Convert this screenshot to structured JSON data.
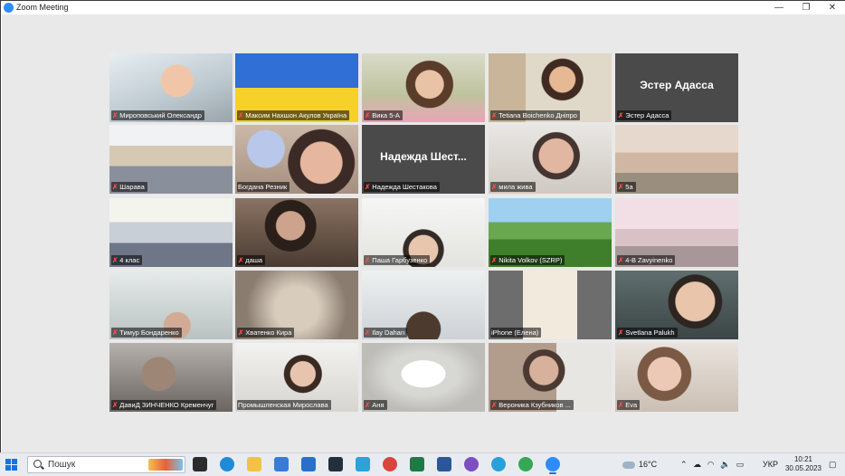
{
  "window": {
    "title": "Zoom Meeting",
    "controls": {
      "minimize": "—",
      "maximize": "❐",
      "close": "✕"
    }
  },
  "participants": [
    {
      "name": "Мироповський Олександр",
      "muted": true,
      "video": true,
      "scene": "boy-glasses"
    },
    {
      "name": "Максим Нахшон Акулов Україна",
      "muted": true,
      "video": true,
      "scene": "flag"
    },
    {
      "name": "Вика 5-А",
      "muted": true,
      "video": true,
      "scene": "girl-room"
    },
    {
      "name": "Tetiana Boichenko Дніпро",
      "muted": true,
      "video": true,
      "scene": "teacher"
    },
    {
      "name": "Эстер Адасса",
      "muted": true,
      "video": false,
      "display_name": "Эстер Адасса"
    },
    {
      "name": "Шарава",
      "muted": true,
      "video": true,
      "scene": "classroom"
    },
    {
      "name": "Богдана Резник",
      "muted": false,
      "video": true,
      "scene": "badge",
      "active_speaker": true
    },
    {
      "name": "Надежда Шестакова",
      "muted": true,
      "video": false,
      "display_name": "Надежда Шест..."
    },
    {
      "name": "мила жива",
      "muted": true,
      "video": true,
      "scene": "girl-headset"
    },
    {
      "name": "5а",
      "muted": true,
      "video": true,
      "scene": "classroom2"
    },
    {
      "name": "4 клас",
      "muted": true,
      "video": true,
      "scene": "class-kids"
    },
    {
      "name": "даша",
      "muted": true,
      "video": true,
      "scene": "girl-dark"
    },
    {
      "name": "Паша Гарбузенко",
      "muted": true,
      "video": true,
      "scene": "boy-bright"
    },
    {
      "name": "Nikita Volkov (SZRP)",
      "muted": true,
      "video": true,
      "scene": "minecraft"
    },
    {
      "name": "4-B Zavyinenko",
      "muted": true,
      "video": true,
      "scene": "classroom3"
    },
    {
      "name": "Тимур Бондаренко",
      "muted": true,
      "video": true,
      "scene": "boy-kitchen"
    },
    {
      "name": "Хватенко Кира",
      "muted": true,
      "video": true,
      "scene": "blur"
    },
    {
      "name": "Ilay Dahan",
      "muted": true,
      "video": true,
      "scene": "boy-headset"
    },
    {
      "name": "iPhone (Елена)",
      "muted": false,
      "video": true,
      "scene": "phone"
    },
    {
      "name": "Svetlana Palukh",
      "muted": true,
      "video": true,
      "scene": "boy-glasses2"
    },
    {
      "name": "ДавиД ЗИНЧЕНКО Кременчуг",
      "muted": true,
      "video": true,
      "scene": "boy-dark"
    },
    {
      "name": "Промышленская Мирослава",
      "muted": false,
      "video": true,
      "scene": "girl-desk"
    },
    {
      "name": "Аня",
      "muted": true,
      "video": true,
      "scene": "ceiling"
    },
    {
      "name": "Вероника Кзубников ...",
      "muted": true,
      "video": true,
      "scene": "woman"
    },
    {
      "name": "Eva",
      "muted": true,
      "video": true,
      "scene": "girl-eva"
    }
  ],
  "taskbar": {
    "search_placeholder": "Пошук",
    "weather": "16°C",
    "language": "УКР",
    "time": "10:21",
    "date": "30.05.2023",
    "apps": [
      "task-view",
      "edge",
      "explorer",
      "store",
      "mail",
      "amazon",
      "photos",
      "chrome",
      "excel",
      "word",
      "viber",
      "telegram",
      "chrome2",
      "zoom"
    ],
    "colors": {
      "accent": "#1a73d9",
      "zoom": "#2d8cff"
    }
  }
}
